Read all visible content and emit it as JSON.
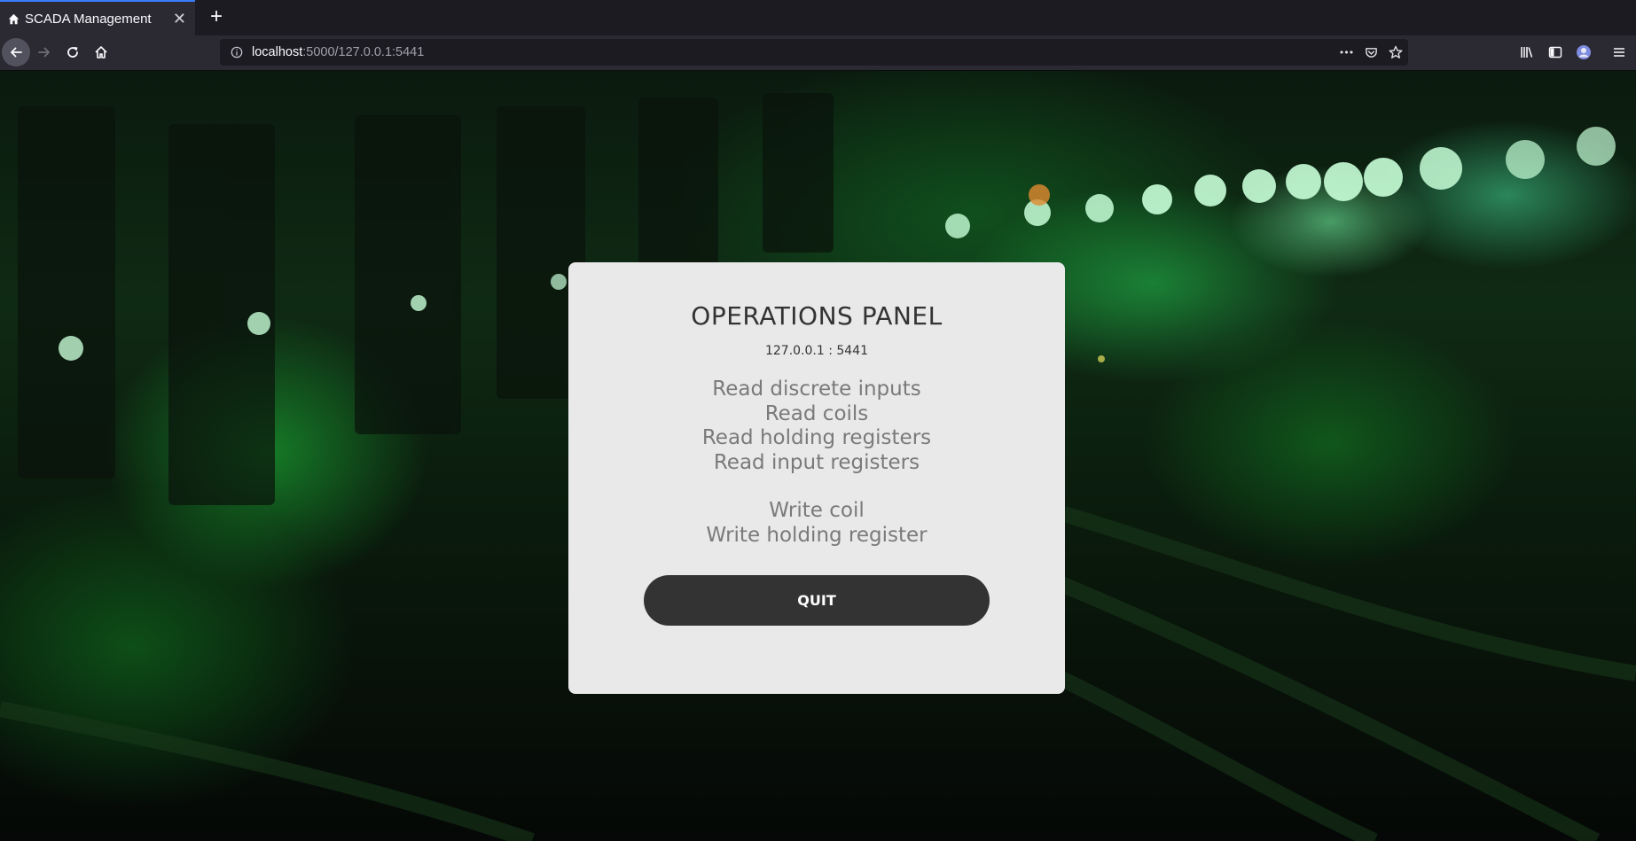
{
  "browser": {
    "tab_title": "SCADA Management",
    "url_host": "localhost",
    "url_rest": ":5000/127.0.0.1:5441",
    "icons": {
      "tab_favicon": "home-icon",
      "back": "back-arrow-icon",
      "forward": "forward-arrow-icon",
      "reload": "reload-icon",
      "home": "home-icon",
      "info": "info-icon",
      "more": "more-dots-icon",
      "pocket": "pocket-icon",
      "bookmark": "star-icon",
      "library": "library-icon",
      "sidebar": "sidebar-icon",
      "account": "account-icon",
      "menu": "hamburger-menu-icon"
    },
    "new_tab_symbol": "+",
    "close_symbol": "✕",
    "more_symbol": "•••"
  },
  "panel": {
    "title": "OPERATIONS PANEL",
    "address": "127.0.0.1 : 5441",
    "read_ops": [
      "Read discrete inputs",
      "Read coils",
      "Read holding registers",
      "Read input registers"
    ],
    "write_ops": [
      "Write coil",
      "Write holding register"
    ],
    "quit_label": "QUIT"
  },
  "colors": {
    "panel_bg": "#e9e9e9",
    "button_bg": "#333333",
    "link_text": "#7a7a7a",
    "accent_tab": "#3b7cff"
  }
}
